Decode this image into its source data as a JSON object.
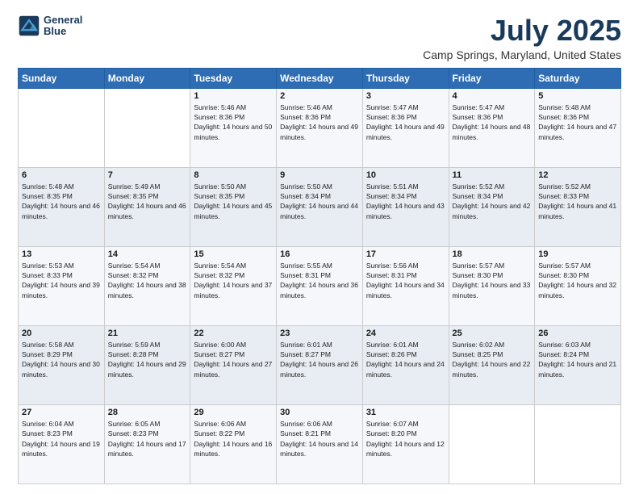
{
  "header": {
    "logo_line1": "General",
    "logo_line2": "Blue",
    "title": "July 2025",
    "subtitle": "Camp Springs, Maryland, United States"
  },
  "weekdays": [
    "Sunday",
    "Monday",
    "Tuesday",
    "Wednesday",
    "Thursday",
    "Friday",
    "Saturday"
  ],
  "weeks": [
    [
      {
        "day": "",
        "sunrise": "",
        "sunset": "",
        "daylight": ""
      },
      {
        "day": "",
        "sunrise": "",
        "sunset": "",
        "daylight": ""
      },
      {
        "day": "1",
        "sunrise": "Sunrise: 5:46 AM",
        "sunset": "Sunset: 8:36 PM",
        "daylight": "Daylight: 14 hours and 50 minutes."
      },
      {
        "day": "2",
        "sunrise": "Sunrise: 5:46 AM",
        "sunset": "Sunset: 8:36 PM",
        "daylight": "Daylight: 14 hours and 49 minutes."
      },
      {
        "day": "3",
        "sunrise": "Sunrise: 5:47 AM",
        "sunset": "Sunset: 8:36 PM",
        "daylight": "Daylight: 14 hours and 49 minutes."
      },
      {
        "day": "4",
        "sunrise": "Sunrise: 5:47 AM",
        "sunset": "Sunset: 8:36 PM",
        "daylight": "Daylight: 14 hours and 48 minutes."
      },
      {
        "day": "5",
        "sunrise": "Sunrise: 5:48 AM",
        "sunset": "Sunset: 8:36 PM",
        "daylight": "Daylight: 14 hours and 47 minutes."
      }
    ],
    [
      {
        "day": "6",
        "sunrise": "Sunrise: 5:48 AM",
        "sunset": "Sunset: 8:35 PM",
        "daylight": "Daylight: 14 hours and 46 minutes."
      },
      {
        "day": "7",
        "sunrise": "Sunrise: 5:49 AM",
        "sunset": "Sunset: 8:35 PM",
        "daylight": "Daylight: 14 hours and 46 minutes."
      },
      {
        "day": "8",
        "sunrise": "Sunrise: 5:50 AM",
        "sunset": "Sunset: 8:35 PM",
        "daylight": "Daylight: 14 hours and 45 minutes."
      },
      {
        "day": "9",
        "sunrise": "Sunrise: 5:50 AM",
        "sunset": "Sunset: 8:34 PM",
        "daylight": "Daylight: 14 hours and 44 minutes."
      },
      {
        "day": "10",
        "sunrise": "Sunrise: 5:51 AM",
        "sunset": "Sunset: 8:34 PM",
        "daylight": "Daylight: 14 hours and 43 minutes."
      },
      {
        "day": "11",
        "sunrise": "Sunrise: 5:52 AM",
        "sunset": "Sunset: 8:34 PM",
        "daylight": "Daylight: 14 hours and 42 minutes."
      },
      {
        "day": "12",
        "sunrise": "Sunrise: 5:52 AM",
        "sunset": "Sunset: 8:33 PM",
        "daylight": "Daylight: 14 hours and 41 minutes."
      }
    ],
    [
      {
        "day": "13",
        "sunrise": "Sunrise: 5:53 AM",
        "sunset": "Sunset: 8:33 PM",
        "daylight": "Daylight: 14 hours and 39 minutes."
      },
      {
        "day": "14",
        "sunrise": "Sunrise: 5:54 AM",
        "sunset": "Sunset: 8:32 PM",
        "daylight": "Daylight: 14 hours and 38 minutes."
      },
      {
        "day": "15",
        "sunrise": "Sunrise: 5:54 AM",
        "sunset": "Sunset: 8:32 PM",
        "daylight": "Daylight: 14 hours and 37 minutes."
      },
      {
        "day": "16",
        "sunrise": "Sunrise: 5:55 AM",
        "sunset": "Sunset: 8:31 PM",
        "daylight": "Daylight: 14 hours and 36 minutes."
      },
      {
        "day": "17",
        "sunrise": "Sunrise: 5:56 AM",
        "sunset": "Sunset: 8:31 PM",
        "daylight": "Daylight: 14 hours and 34 minutes."
      },
      {
        "day": "18",
        "sunrise": "Sunrise: 5:57 AM",
        "sunset": "Sunset: 8:30 PM",
        "daylight": "Daylight: 14 hours and 33 minutes."
      },
      {
        "day": "19",
        "sunrise": "Sunrise: 5:57 AM",
        "sunset": "Sunset: 8:30 PM",
        "daylight": "Daylight: 14 hours and 32 minutes."
      }
    ],
    [
      {
        "day": "20",
        "sunrise": "Sunrise: 5:58 AM",
        "sunset": "Sunset: 8:29 PM",
        "daylight": "Daylight: 14 hours and 30 minutes."
      },
      {
        "day": "21",
        "sunrise": "Sunrise: 5:59 AM",
        "sunset": "Sunset: 8:28 PM",
        "daylight": "Daylight: 14 hours and 29 minutes."
      },
      {
        "day": "22",
        "sunrise": "Sunrise: 6:00 AM",
        "sunset": "Sunset: 8:27 PM",
        "daylight": "Daylight: 14 hours and 27 minutes."
      },
      {
        "day": "23",
        "sunrise": "Sunrise: 6:01 AM",
        "sunset": "Sunset: 8:27 PM",
        "daylight": "Daylight: 14 hours and 26 minutes."
      },
      {
        "day": "24",
        "sunrise": "Sunrise: 6:01 AM",
        "sunset": "Sunset: 8:26 PM",
        "daylight": "Daylight: 14 hours and 24 minutes."
      },
      {
        "day": "25",
        "sunrise": "Sunrise: 6:02 AM",
        "sunset": "Sunset: 8:25 PM",
        "daylight": "Daylight: 14 hours and 22 minutes."
      },
      {
        "day": "26",
        "sunrise": "Sunrise: 6:03 AM",
        "sunset": "Sunset: 8:24 PM",
        "daylight": "Daylight: 14 hours and 21 minutes."
      }
    ],
    [
      {
        "day": "27",
        "sunrise": "Sunrise: 6:04 AM",
        "sunset": "Sunset: 8:23 PM",
        "daylight": "Daylight: 14 hours and 19 minutes."
      },
      {
        "day": "28",
        "sunrise": "Sunrise: 6:05 AM",
        "sunset": "Sunset: 8:23 PM",
        "daylight": "Daylight: 14 hours and 17 minutes."
      },
      {
        "day": "29",
        "sunrise": "Sunrise: 6:06 AM",
        "sunset": "Sunset: 8:22 PM",
        "daylight": "Daylight: 14 hours and 16 minutes."
      },
      {
        "day": "30",
        "sunrise": "Sunrise: 6:06 AM",
        "sunset": "Sunset: 8:21 PM",
        "daylight": "Daylight: 14 hours and 14 minutes."
      },
      {
        "day": "31",
        "sunrise": "Sunrise: 6:07 AM",
        "sunset": "Sunset: 8:20 PM",
        "daylight": "Daylight: 14 hours and 12 minutes."
      },
      {
        "day": "",
        "sunrise": "",
        "sunset": "",
        "daylight": ""
      },
      {
        "day": "",
        "sunrise": "",
        "sunset": "",
        "daylight": ""
      }
    ]
  ]
}
